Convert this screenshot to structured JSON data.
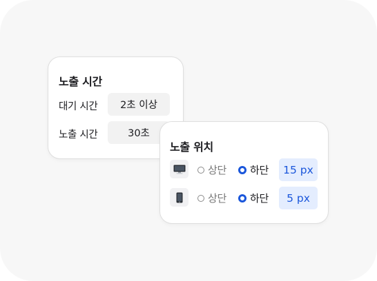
{
  "exposure_time": {
    "title": "노출 시간",
    "rows": [
      {
        "label": "대기 시간",
        "value": "2초 이상"
      },
      {
        "label": "노출 시간",
        "value": "30초"
      }
    ]
  },
  "exposure_position": {
    "title": "노출 위치",
    "rows": [
      {
        "device": "desktop-monitor-icon",
        "top_label": "상단",
        "bottom_label": "하단",
        "selected": "하단",
        "offset": "15 px"
      },
      {
        "device": "mobile-phone-icon",
        "top_label": "상단",
        "bottom_label": "하단",
        "selected": "하단",
        "offset": "5 px"
      }
    ]
  },
  "colors": {
    "accent": "#1a56db",
    "accent_bg": "#e4edfe",
    "field_bg": "#f2f2f2",
    "canvas_bg": "#f7f7f7"
  }
}
